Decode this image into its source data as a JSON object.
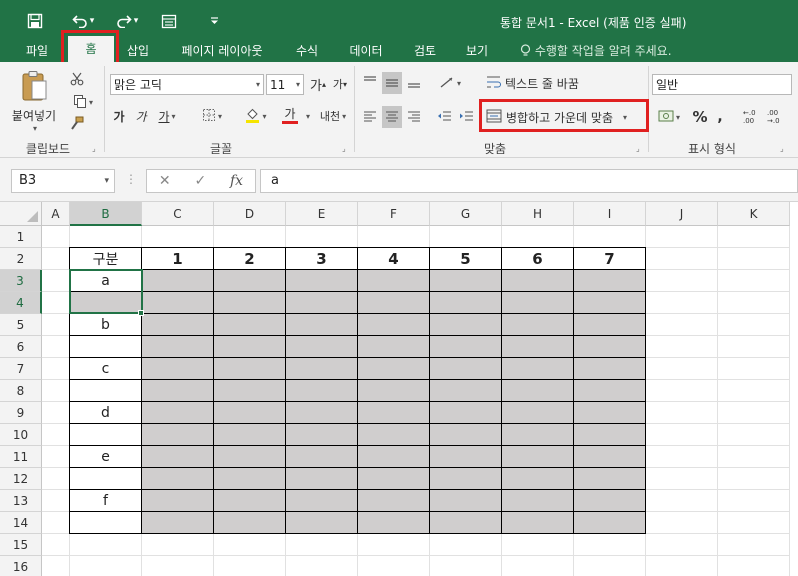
{
  "quick_access": {
    "save_icon": "save-icon",
    "undo_icon": "undo-icon",
    "redo_icon": "redo-icon",
    "form_icon": "form-icon",
    "customize_icon": "customize-qat-icon"
  },
  "window": {
    "title": "통합 문서1  -  Excel (제품 인증 실패)"
  },
  "tabs": [
    {
      "label": "파일"
    },
    {
      "label": "홈"
    },
    {
      "label": "삽입"
    },
    {
      "label": "페이지 레이아웃"
    },
    {
      "label": "수식"
    },
    {
      "label": "데이터"
    },
    {
      "label": "검토"
    },
    {
      "label": "보기"
    }
  ],
  "tell_me": "수행할 작업을 알려 주세요.",
  "ribbon": {
    "clipboard": {
      "label": "클립보드",
      "paste_label": "붙여넣기"
    },
    "font": {
      "label": "글꼴",
      "font_name": "맑은 고딕",
      "font_size": "11",
      "grow_label": "가",
      "shrink_label": "가",
      "bold_label": "가",
      "italic_label": "가",
      "underline_label": "가",
      "font_color_label": "가",
      "phonetic_label": "내천",
      "font_color": "#e02020"
    },
    "alignment": {
      "label": "맞춤",
      "wrap_text": "텍스트 줄 바꿈",
      "merge_center": "병합하고 가운데 맞춤"
    },
    "number": {
      "label": "표시 형식",
      "format": "일반",
      "percent": "%"
    }
  },
  "formula_bar": {
    "name_box": "B3",
    "fx": "fx",
    "value": "a"
  },
  "sheet": {
    "columns": [
      "A",
      "B",
      "C",
      "D",
      "E",
      "F",
      "G",
      "H",
      "I",
      "J",
      "K"
    ],
    "rows": [
      "1",
      "2",
      "3",
      "4",
      "5",
      "6",
      "7",
      "8",
      "9",
      "10",
      "11",
      "12",
      "13",
      "14",
      "15",
      "16"
    ],
    "selected_column": "B",
    "selected_rows": [
      "3",
      "4"
    ],
    "header_label": "구분",
    "header_numbers": [
      "1",
      "2",
      "3",
      "4",
      "5",
      "6",
      "7"
    ],
    "category_labels": [
      "a",
      "",
      "b",
      "",
      "c",
      "",
      "d",
      "",
      "e",
      "",
      "f",
      ""
    ],
    "fill_color": "#d0cece",
    "accent_color": "#217346"
  }
}
